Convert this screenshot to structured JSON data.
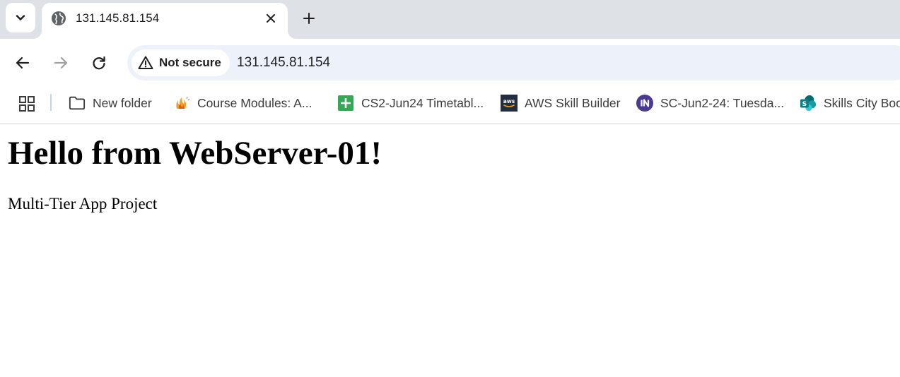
{
  "tab": {
    "title": "131.145.81.154",
    "favicon": "globe-icon"
  },
  "toolbar": {
    "back_icon": "arrow-left-icon",
    "forward_icon": "arrow-right-icon",
    "reload_icon": "reload-icon"
  },
  "omnibox": {
    "security_label": "Not secure",
    "security_icon": "warning-triangle-icon",
    "url": "131.145.81.154"
  },
  "bookmarks": {
    "items": [
      {
        "label": "New folder",
        "icon": "folder-icon"
      },
      {
        "label": "Course Modules: A...",
        "icon": "course-favicon"
      },
      {
        "label": "CS2-Jun24 Timetabl...",
        "icon": "google-sheets-icon",
        "color": "#34a853"
      },
      {
        "label": "AWS Skill Builder",
        "icon": "aws-icon",
        "color": "#232f3e"
      },
      {
        "label": "SC-Jun2-24: Tuesda...",
        "icon": "in-badge-icon",
        "color": "#4b3a8f"
      },
      {
        "label": "Skills City Boo",
        "icon": "sharepoint-icon",
        "color": "#038387"
      }
    ]
  },
  "page": {
    "heading": "Hello from WebServer-01!",
    "paragraph": "Multi-Tier App Project"
  }
}
